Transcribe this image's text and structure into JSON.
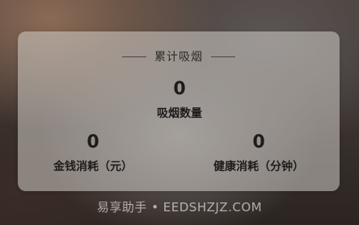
{
  "card": {
    "title": "累计吸烟",
    "smoke_count": {
      "value": "0",
      "label": "吸烟数量"
    },
    "money_spent": {
      "value": "0",
      "label": "金钱消耗（元）"
    },
    "health_cost": {
      "value": "0",
      "label": "健康消耗（分钟）"
    }
  },
  "watermark": "易享助手 • EEDSHZJZ.COM"
}
